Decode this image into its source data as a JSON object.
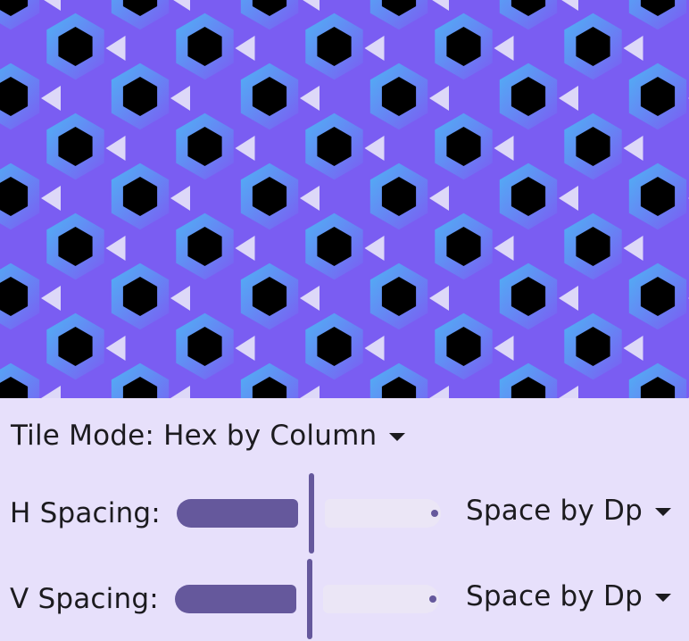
{
  "tile_mode": {
    "label": "Tile Mode: Hex by Column"
  },
  "h_spacing": {
    "label": "H Spacing:",
    "value": 0.5,
    "mode_label": "Space by Dp"
  },
  "v_spacing": {
    "label": "V Spacing:",
    "value": 0.5,
    "mode_label": "Space by Dp"
  },
  "colors": {
    "pattern_light_blue": "#4fb2f4",
    "pattern_purple": "#7b5cf3",
    "hex_hole": "#000000",
    "triangle": "#ddd8f8",
    "panel_background": "#e7e0fb",
    "slider_accent": "#65589c"
  }
}
